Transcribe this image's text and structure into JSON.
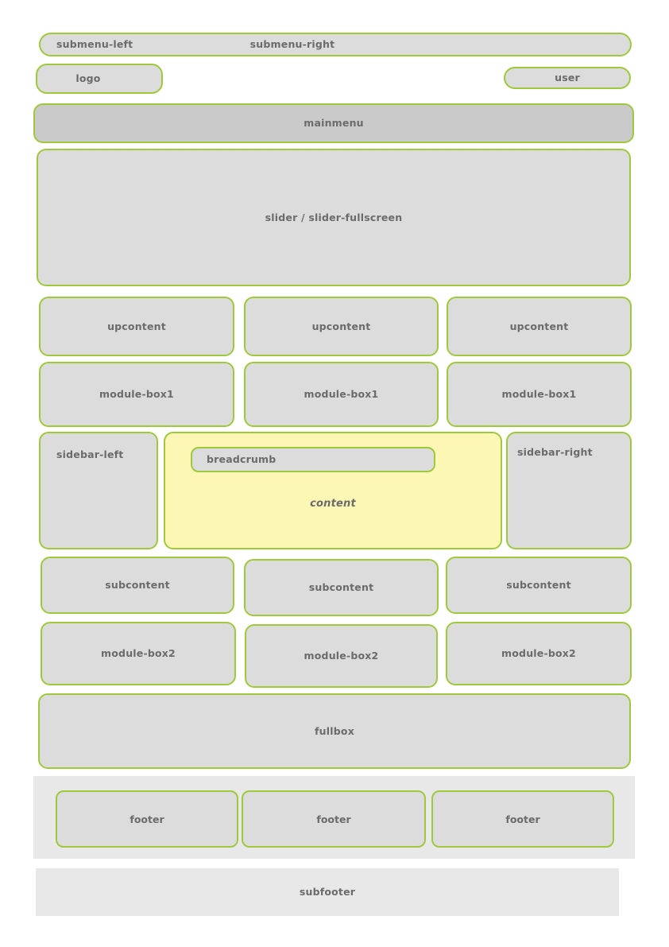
{
  "page": {
    "title": "Page layout wireframe",
    "background": "#ffffff",
    "accent_border": "#9fc93c",
    "block_fill": "#dcdcdc",
    "block_fill_dark": "#cacaca",
    "content_fill": "#fdf7b5",
    "footer_band_fill": "#e8e8e8",
    "text_color": "#6b6b6b"
  },
  "regions": {
    "submenu_left": "submenu-left",
    "submenu_right": "submenu-right",
    "logo": "logo",
    "user": "user",
    "mainmenu": "mainmenu",
    "slider": "slider / slider-fullscreen",
    "upcontent": [
      "upcontent",
      "upcontent",
      "upcontent"
    ],
    "module_box1": [
      "module-box1",
      "module-box1",
      "module-box1"
    ],
    "sidebar_left": "sidebar-left",
    "sidebar_right": "sidebar-right",
    "breadcrumb": "breadcrumb",
    "content": "content",
    "subcontent": [
      "subcontent",
      "subcontent",
      "subcontent"
    ],
    "module_box2": [
      "module-box2",
      "module-box2",
      "module-box2"
    ],
    "fullbox": "fullbox",
    "footer": [
      "footer",
      "footer",
      "footer"
    ],
    "subfooter": "subfooter"
  }
}
